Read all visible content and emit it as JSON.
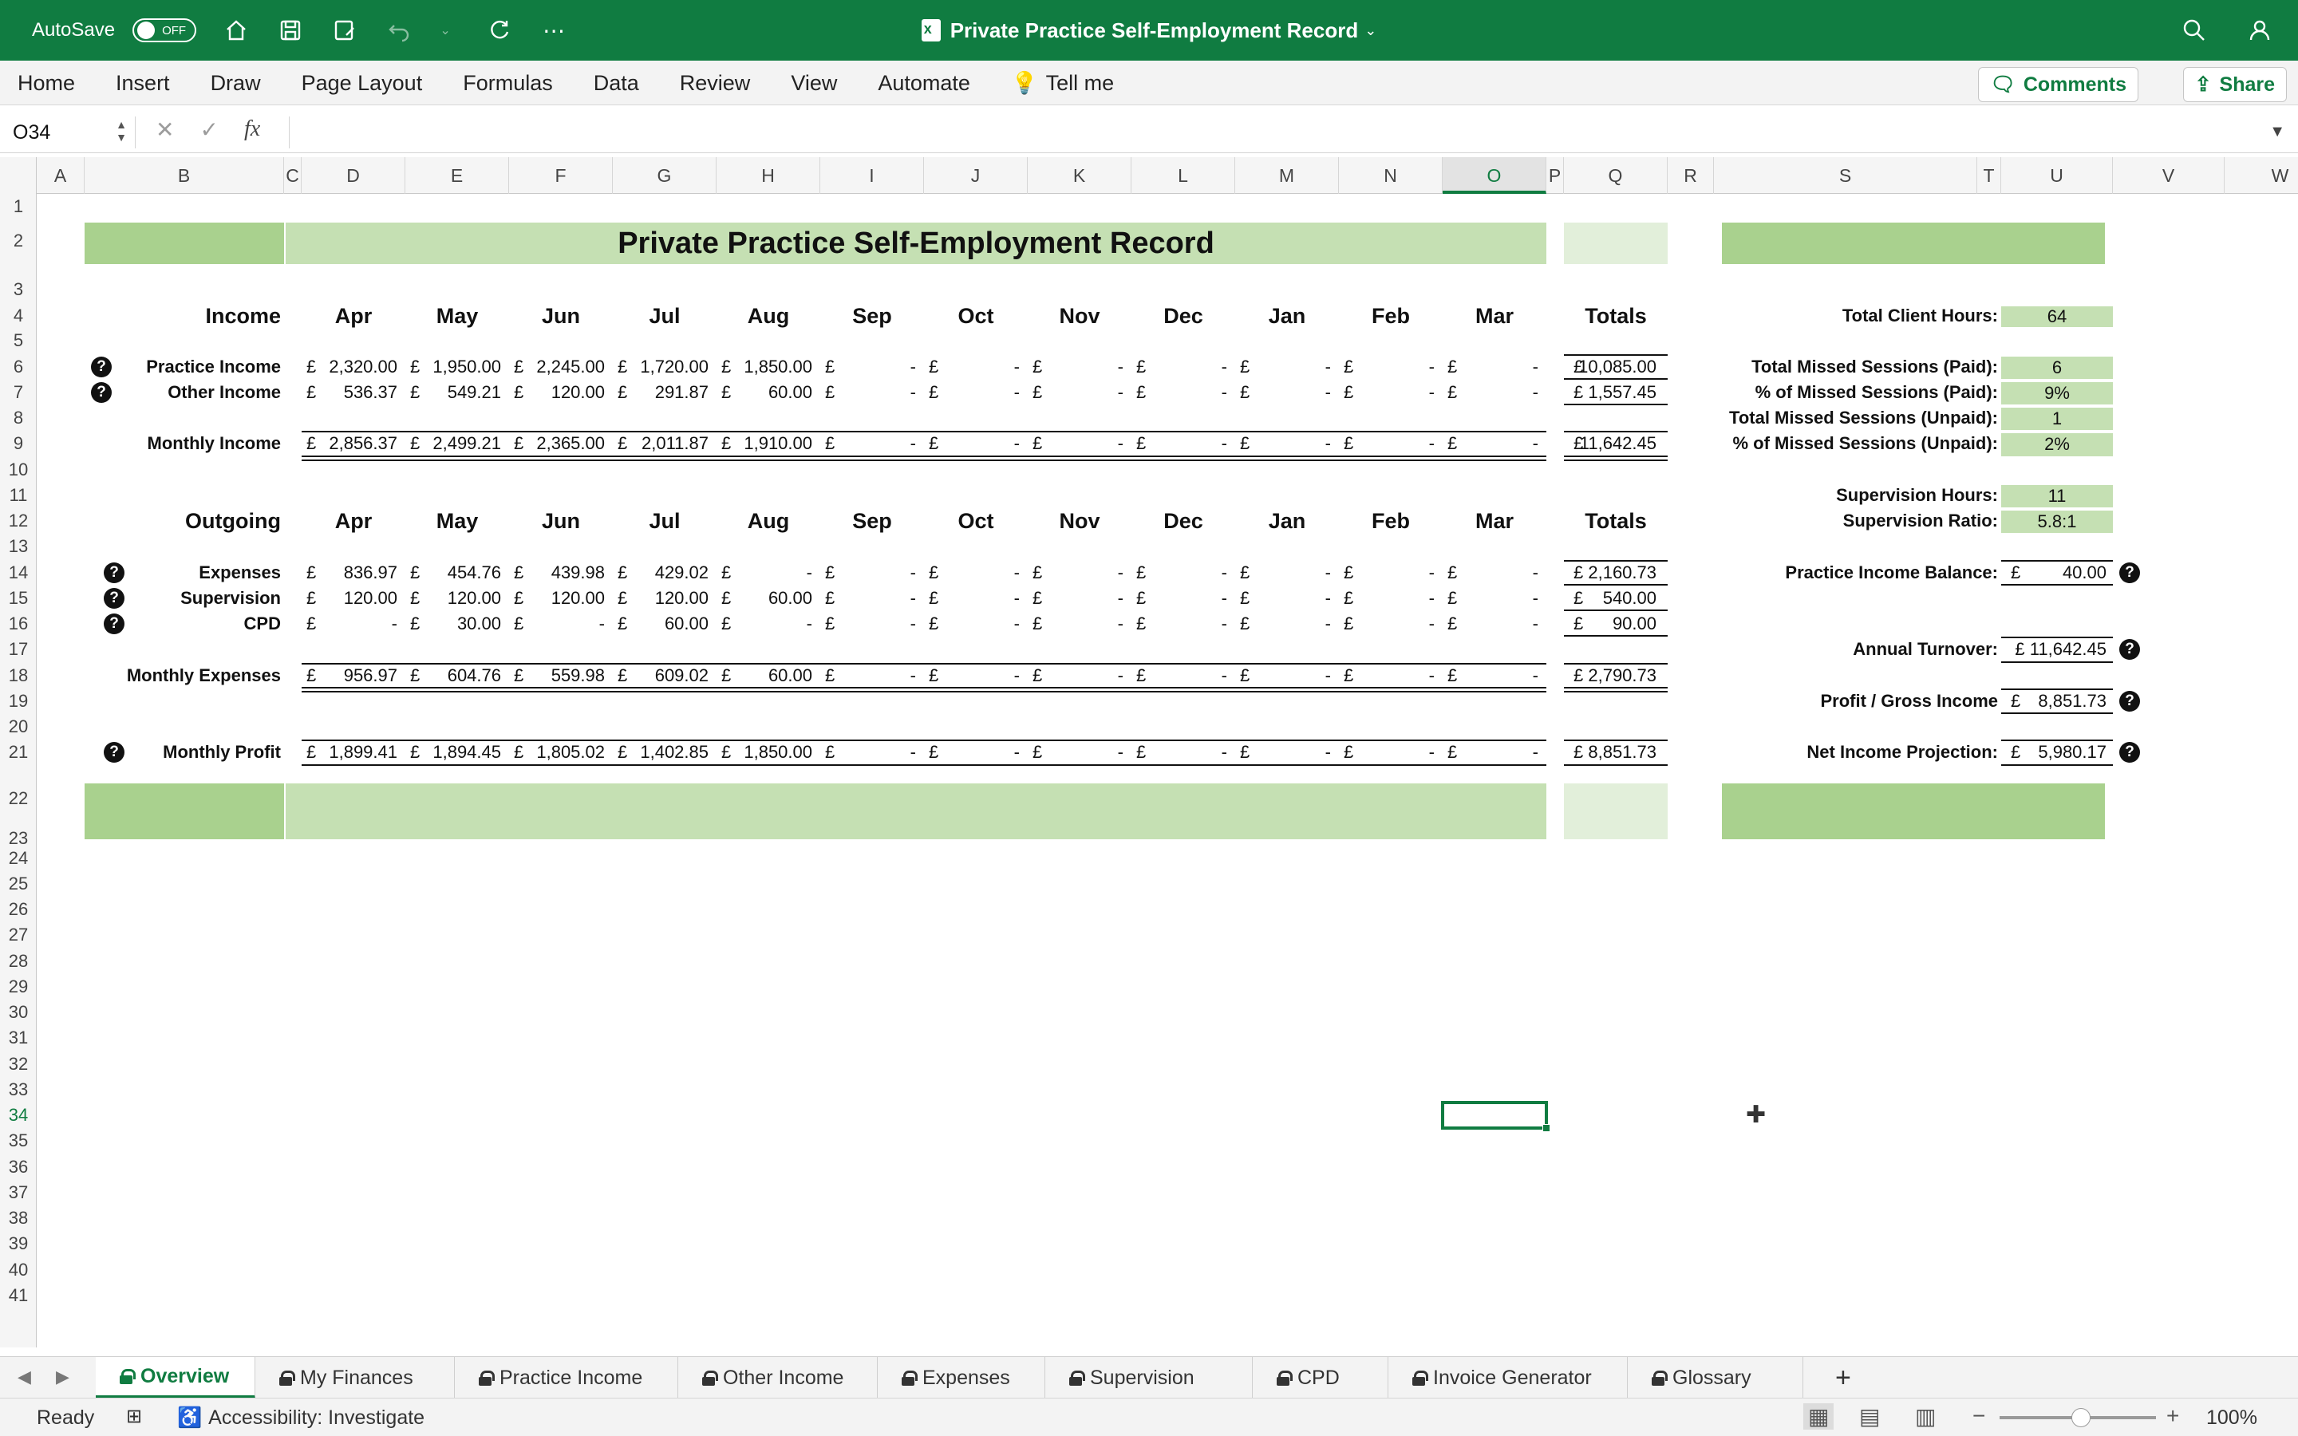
{
  "titlebar": {
    "autosave_label": "AutoSave",
    "autosave_state": "OFF",
    "doc_title": "Private Practice Self-Employment Record"
  },
  "ribbon": {
    "tabs": [
      "Home",
      "Insert",
      "Draw",
      "Page Layout",
      "Formulas",
      "Data",
      "Review",
      "View",
      "Automate"
    ],
    "tell_me": "Tell me",
    "comments": "Comments",
    "share": "Share"
  },
  "formula_bar": {
    "name_box": "O34",
    "fx": "fx",
    "value": ""
  },
  "columns": [
    "A",
    "B",
    "C",
    "D",
    "E",
    "F",
    "G",
    "H",
    "I",
    "J",
    "K",
    "L",
    "M",
    "N",
    "O",
    "P",
    "Q",
    "R",
    "S",
    "T",
    "U",
    "V",
    "W"
  ],
  "selected_column": "O",
  "rows": [
    "1",
    "2",
    "3",
    "4",
    "5",
    "6",
    "7",
    "8",
    "9",
    "10",
    "11",
    "12",
    "13",
    "14",
    "15",
    "16",
    "17",
    "18",
    "19",
    "20",
    "21",
    "22",
    "23",
    "24",
    "25",
    "26",
    "27",
    "28",
    "29",
    "30",
    "31",
    "32",
    "33",
    "34",
    "35",
    "36",
    "37",
    "38",
    "39",
    "40",
    "41"
  ],
  "selected_row": "34",
  "sheet": {
    "title": "Private Practice Self-Employment Record",
    "months": [
      "Apr",
      "May",
      "Jun",
      "Jul",
      "Aug",
      "Sep",
      "Oct",
      "Nov",
      "Dec",
      "Jan",
      "Feb",
      "Mar"
    ],
    "totals_label": "Totals",
    "currency": "£",
    "income": {
      "heading": "Income",
      "rows": [
        {
          "label": "Practice Income",
          "values": [
            "2,320.00",
            "1,950.00",
            "2,245.00",
            "1,720.00",
            "1,850.00",
            "-",
            "-",
            "-",
            "-",
            "-",
            "-",
            "-"
          ],
          "total": "10,085.00"
        },
        {
          "label": "Other Income",
          "values": [
            "536.37",
            "549.21",
            "120.00",
            "291.87",
            "60.00",
            "-",
            "-",
            "-",
            "-",
            "-",
            "-",
            "-"
          ],
          "total": "1,557.45"
        }
      ],
      "sum": {
        "label": "Monthly  Income",
        "values": [
          "2,856.37",
          "2,499.21",
          "2,365.00",
          "2,011.87",
          "1,910.00",
          "-",
          "-",
          "-",
          "-",
          "-",
          "-",
          "-"
        ],
        "total": "11,642.45"
      }
    },
    "outgoing": {
      "heading": "Outgoing",
      "rows": [
        {
          "label": "Expenses",
          "values": [
            "836.97",
            "454.76",
            "439.98",
            "429.02",
            "-",
            "-",
            "-",
            "-",
            "-",
            "-",
            "-",
            "-"
          ],
          "total": "2,160.73"
        },
        {
          "label": "Supervision",
          "values": [
            "120.00",
            "120.00",
            "120.00",
            "120.00",
            "60.00",
            "-",
            "-",
            "-",
            "-",
            "-",
            "-",
            "-"
          ],
          "total": "540.00"
        },
        {
          "label": "CPD",
          "values": [
            "-",
            "30.00",
            "-",
            "60.00",
            "-",
            "-",
            "-",
            "-",
            "-",
            "-",
            "-",
            "-"
          ],
          "total": "90.00"
        }
      ],
      "sum": {
        "label": "Monthly Expenses",
        "values": [
          "956.97",
          "604.76",
          "559.98",
          "609.02",
          "60.00",
          "-",
          "-",
          "-",
          "-",
          "-",
          "-",
          "-"
        ],
        "total": "2,790.73"
      }
    },
    "profit": {
      "label": "Monthly Profit",
      "values": [
        "1,899.41",
        "1,894.45",
        "1,805.02",
        "1,402.85",
        "1,850.00",
        "-",
        "-",
        "-",
        "-",
        "-",
        "-",
        "-"
      ],
      "total": "8,851.73"
    },
    "stats": {
      "total_client_hours_label": "Total Client Hours:",
      "total_client_hours": "64",
      "missed_paid_label": "Total Missed Sessions (Paid):",
      "missed_paid": "6",
      "pct_missed_paid_label": "% of Missed Sessions (Paid):",
      "pct_missed_paid": "9%",
      "missed_unpaid_label": "Total Missed Sessions (Unpaid):",
      "missed_unpaid": "1",
      "pct_missed_unpaid_label": "% of Missed Sessions (Unpaid):",
      "pct_missed_unpaid": "2%",
      "supervision_hours_label": "Supervision Hours:",
      "supervision_hours": "11",
      "supervision_ratio_label": "Supervision Ratio:",
      "supervision_ratio": "5.8:1",
      "balance_label": "Practice Income Balance:",
      "balance": "40.00",
      "turnover_label": "Annual Turnover:",
      "turnover": "£ 11,642.45",
      "profit_label": "Profit / Gross Income",
      "profit": "8,851.73",
      "net_label": "Net Income Projection:",
      "net": "5,980.17"
    }
  },
  "sheet_tabs": [
    "Overview",
    "My Finances",
    "Practice Income",
    "Other Income",
    "Expenses",
    "Supervision",
    "CPD",
    "Invoice Generator",
    "Glossary"
  ],
  "active_sheet": "Overview",
  "status": {
    "ready": "Ready",
    "accessibility": "Accessibility: Investigate",
    "zoom": "100%"
  },
  "colors": {
    "excel_green": "#107c41",
    "band_dark": "#a9d18e",
    "band_light": "#c5e0b3",
    "band_pale": "#e2efda"
  }
}
